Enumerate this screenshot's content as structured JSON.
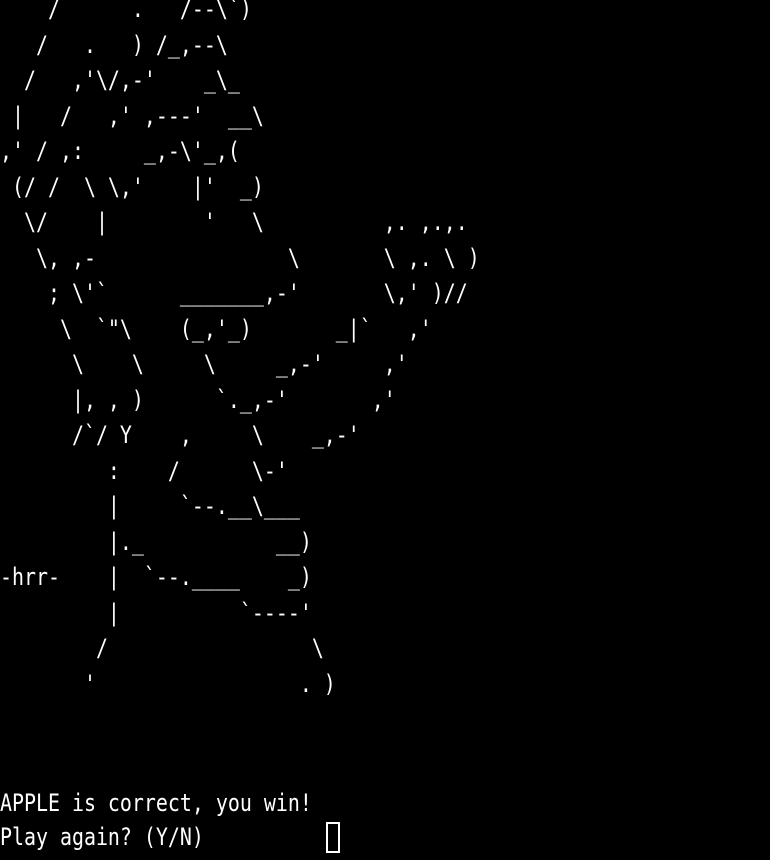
{
  "terminal": {
    "background_color": "#000000",
    "text_color": "#ffffff",
    "ascii_art": "    /      .   /--\\`)\n   /   .   ) /_,--\\\n  /   ,'\\/,-'    _\\_\n |   /   ,' ,---'  __\\\n,' / ,:     _,-\\'_,(\n (/ /  \\ \\,'    |'  _)\n  \\/    |        '   \\          ,. ,.,.\n   \\, ,-                \\       \\ ,. \\ )\n    ; \\'`      _______,-'       \\,' )//\n     \\  `\"\\    (_,'_)       _|`   ,'\n      \\    \\     \\     _,-'     ,'\n      |, , )      `._,-'       ,'\n      /`/ Y    ,     \\    _,-'\n         :    /      \\-'\n         |     `--.__\\___\n         |._           __)\n-hrr-    |  `--.____    _)\n         |          `----'\n        /                 \\\n       '                 . )",
    "result_text": "APPLE is correct, you win!",
    "prompt_text": "Play again? (Y/N) ",
    "input_value": ""
  }
}
